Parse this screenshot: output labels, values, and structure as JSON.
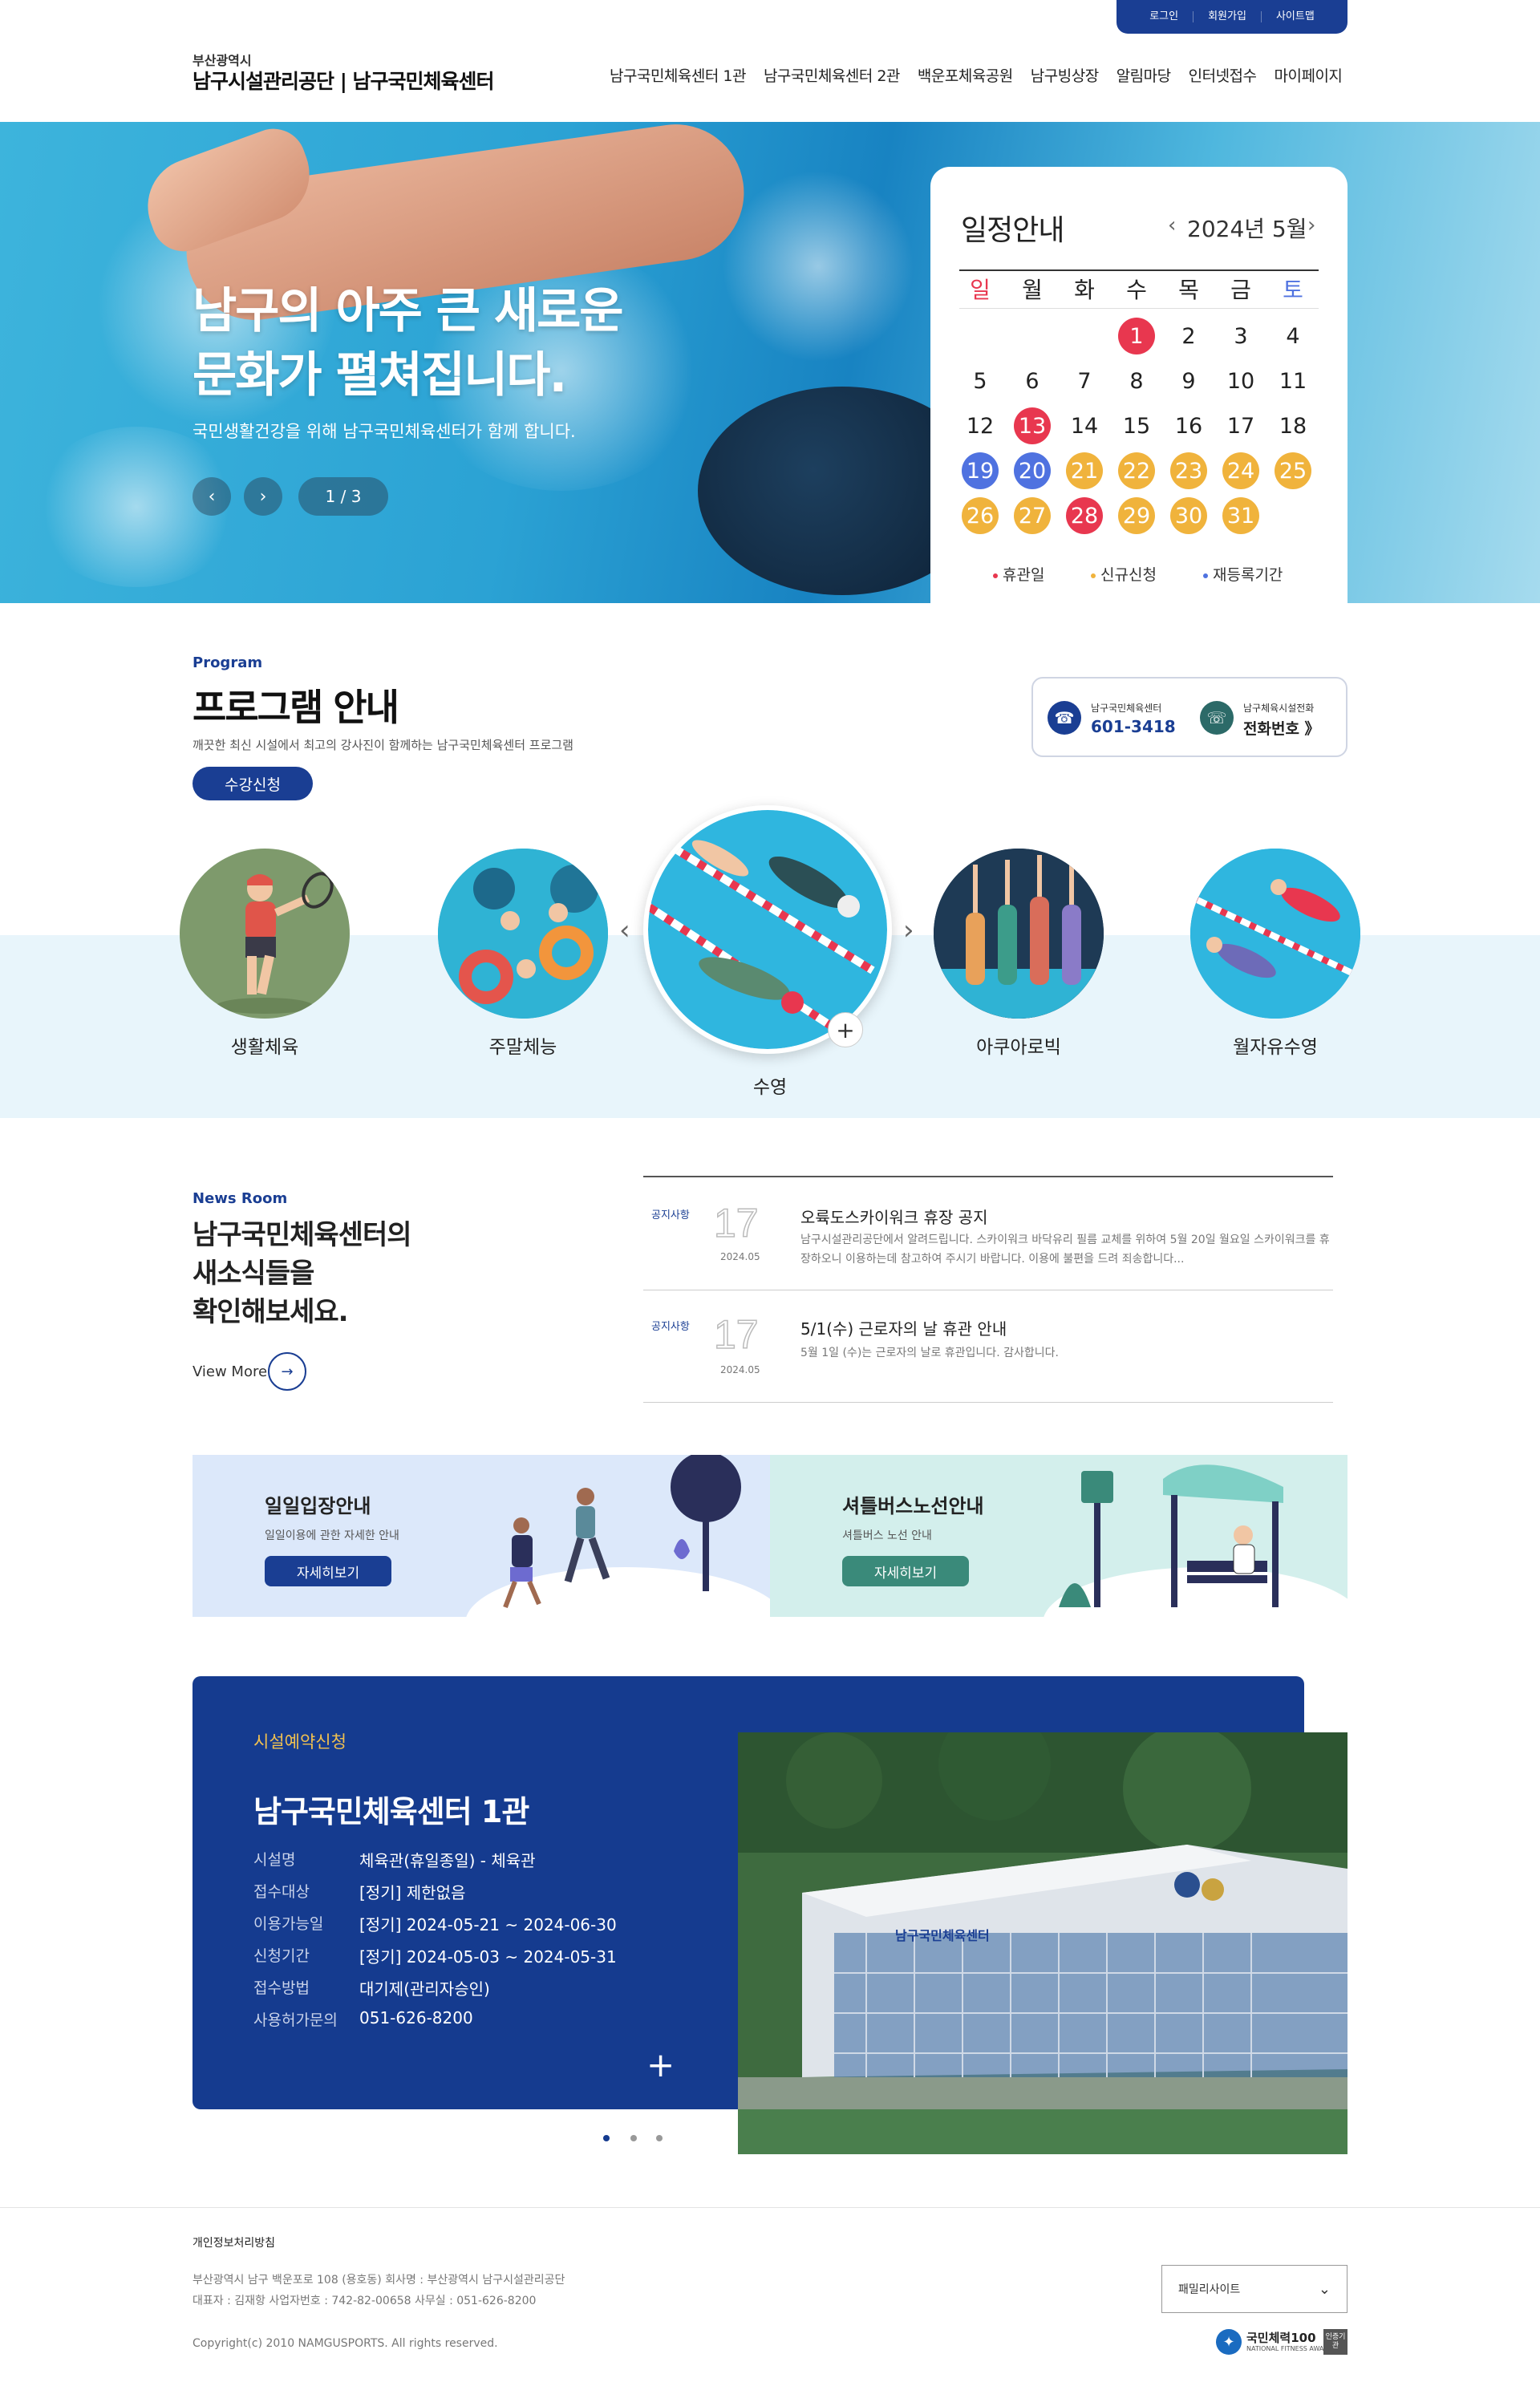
{
  "util": {
    "login": "로그인",
    "join": "회원가입",
    "sitemap": "사이트맵"
  },
  "header": {
    "logo_sub": "부산광역시",
    "logo_main": "남구시설관리공단 | 남구국민체육센터",
    "nav": [
      "남구국민체육센터 1관",
      "남구국민체육센터 2관",
      "백운포체육공원",
      "남구빙상장",
      "알림마당",
      "인터넷접수",
      "마이페이지"
    ]
  },
  "hero": {
    "title_line1": "남구의 아주 큰 새로운",
    "title_line2": "문화가 펼쳐집니다.",
    "subtitle": "국민생활건강을 위해 남구국민체육센터가 함께 합니다.",
    "prev": "‹",
    "next": "›",
    "counter": "1 / 3"
  },
  "calendar": {
    "title": "일정안내",
    "month": "2024년 5월",
    "weekdays": [
      "일",
      "월",
      "화",
      "수",
      "목",
      "금",
      "토"
    ],
    "legend": {
      "holiday": "휴관일",
      "new": "신규신청",
      "re": "재등록기간"
    },
    "colors": {
      "holiday": "#e8374f",
      "new": "#f0b33c",
      "re": "#4f72e0"
    }
  },
  "program": {
    "label": "Program",
    "title": "프로그램 안내",
    "desc": "깨끗한 최신 시설에서 최고의 강사진이 함께하는 남구국민체육센터 프로그램",
    "apply": "수강신청",
    "phone1_label": "남구국민체육센터",
    "phone1_value": "601-3418",
    "phone2_label": "남구체육시설전화",
    "phone2_value": "전화번호 》",
    "items": [
      "생활체육",
      "주말체능",
      "수영",
      "아쿠아로빅",
      "월자유수영"
    ],
    "plus": "+"
  },
  "news": {
    "label": "News Room",
    "title_line1": "남구국민체육센터의",
    "title_line2": "새소식들을",
    "title_line3": "확인해보세요.",
    "view_more": "View More",
    "items": [
      {
        "tag": "공지사항",
        "day": "17",
        "ym": "2024.05",
        "title": "오륙도스카이워크 휴장 공지",
        "desc": "남구시설관리공단에서 알려드립니다. 스카이워크 바닥유리 필름 교체를 위하여 5월 20일 월요일 스카이워크를 휴장하오니 이용하는데 참고하여 주시기 바랍니다. 이용에 불편을 드려 죄송합니다..."
      },
      {
        "tag": "공지사항",
        "day": "17",
        "ym": "2024.05",
        "title": "5/1(수) 근로자의 날 휴관 안내",
        "desc": "5월 1일 (수)는 근로자의 날로 휴관입니다. 감사합니다."
      }
    ]
  },
  "banners": [
    {
      "title": "일일입장안내",
      "desc": "일일이용에 관한 자세한 안내",
      "btn": "자세히보기"
    },
    {
      "title": "셔틀버스노선안내",
      "desc": "셔틀버스 노선 안내",
      "btn": "자세히보기"
    }
  ],
  "reservation": {
    "label": "시설예약신청",
    "title": "남구국민체육센터 1관",
    "rows": [
      {
        "k": "시설명",
        "v": "체육관(휴일종일) - 체육관"
      },
      {
        "k": "접수대상",
        "v": "[정기] 제한없음"
      },
      {
        "k": "이용가능일",
        "v": "[정기] 2024-05-21 ~ 2024-06-30"
      },
      {
        "k": "신청기간",
        "v": "[정기] 2024-05-03 ~ 2024-05-31"
      },
      {
        "k": "접수방법",
        "v": "대기제(관리자승인)"
      },
      {
        "k": "사용허가문의",
        "v": "051-626-8200"
      }
    ],
    "plus": "+",
    "sign": "남구국민체육센터"
  },
  "footer": {
    "privacy": "개인정보처리방침",
    "addr": "부산광역시 남구 백운포로 108 (용호동)    회사명 : 부산광역시 남구시설관리공단",
    "ceo": "대표자 : 김재항    사업자번호 : 742-82-00658    사무실 : 051-626-8200",
    "copy": "Copyright(c) 2010 NAMGUSPORTS. All rights reserved.",
    "family": "패밀리사이트",
    "award": "국민체력100",
    "award_sub": "NATIONAL FITNESS AWARD",
    "award_badge": "인증기관"
  }
}
